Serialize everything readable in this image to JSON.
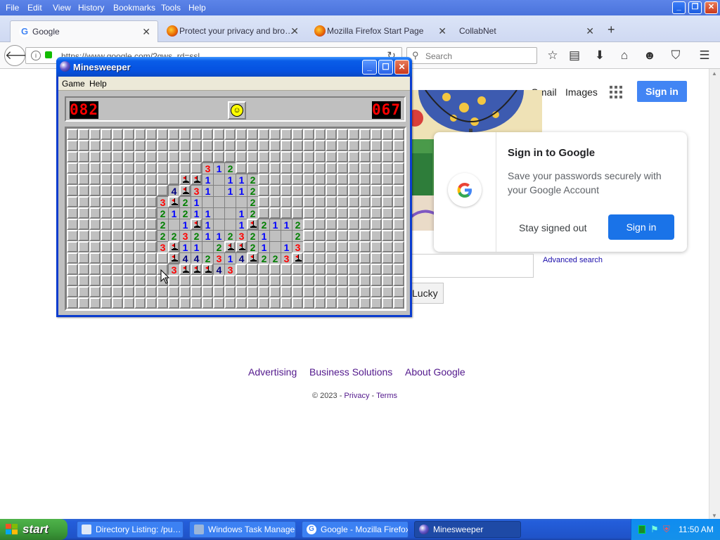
{
  "firefox": {
    "menu": [
      "File",
      "Edit",
      "View",
      "History",
      "Bookmarks",
      "Tools",
      "Help"
    ],
    "tabs": [
      {
        "label": "Google",
        "active": true
      },
      {
        "label": "Protect your privacy and bro…",
        "active": false
      },
      {
        "label": "Mozilla Firefox Start Page",
        "active": false
      },
      {
        "label": "CollabNet",
        "active": false
      }
    ],
    "new_tab": "+",
    "url": "https://www.google.com/?gws_rd=ssl",
    "search_placeholder": "Search"
  },
  "google": {
    "gmail": "Gmail",
    "images": "Images",
    "sign_in": "Sign in",
    "popup": {
      "title": "Sign in to Google",
      "body": "Save your passwords securely with your Google Account",
      "stay": "Stay signed out",
      "sign_in": "Sign in"
    },
    "advanced_search": "Advanced search",
    "lucky": "Lucky",
    "footer": [
      "Advertising",
      "Business Solutions",
      "About Google"
    ],
    "copyright": "© 2023 - ",
    "privacy": "Privacy",
    "sep": " - ",
    "terms": "Terms"
  },
  "minesweeper": {
    "title": "Minesweeper",
    "menu": [
      "Game",
      "Help"
    ],
    "mine_counter": "082",
    "timer": "067",
    "cols": 30,
    "rows": 16,
    "number_colors": {
      "1": "#0000ff",
      "2": "#008000",
      "3": "#ff0000",
      "4": "#000080"
    },
    "revealed": [
      "r3c12:3",
      "r3c13:1",
      "r3c14:2",
      "r4c10:1",
      "r4c11:1",
      "r4c12:1",
      "r4c13:.",
      "r4c14:1",
      "r4c15:1",
      "r4c16:2",
      "r5c9:4",
      "r5c10:F",
      "r5c11:3",
      "r5c12:1",
      "r5c13:.",
      "r5c14:1",
      "r5c15:1",
      "r5c16:2",
      "r6c8:3",
      "r6c9:1",
      "r6c10:2",
      "r6c11:1",
      "r6c12:.",
      "r6c13:.",
      "r6c14:.",
      "r6c15:.",
      "r6c16:2",
      "r7c8:2",
      "r7c9:1",
      "r7c10:2",
      "r7c11:1",
      "r7c12:1",
      "r7c13:.",
      "r7c14:.",
      "r7c15:1",
      "r7c16:2",
      "r8c8:2",
      "r8c9:.",
      "r8c10:1",
      "r8c11:F",
      "r8c12:1",
      "r8c13:.",
      "r8c14:.",
      "r8c15:1",
      "r8c16:F",
      "r8c17:2",
      "r8c18:1",
      "r8c19:1",
      "r8c20:2",
      "r9c8:2",
      "r9c9:2",
      "r9c10:3",
      "r9c11:2",
      "r9c12:1",
      "r9c13:1",
      "r9c14:2",
      "r9c15:3",
      "r9c16:2",
      "r9c17:1",
      "r9c18:.",
      "r9c19:.",
      "r9c20:2",
      "r10c8:3",
      "r10c9:1",
      "r10c10:1",
      "r10c11:1",
      "r10c12:.",
      "r10c13:2",
      "r10c14:1",
      "r10c15:1",
      "r10c16:2",
      "r10c17:1",
      "r10c18:.",
      "r10c19:1",
      "r10c20:3",
      "r11c9:4",
      "r11c10:4",
      "r11c11:4",
      "r11c12:2",
      "r11c13:3",
      "r11c14:1",
      "r11c15:4",
      "r11c16:1",
      "r11c17:2",
      "r11c18:2",
      "r11c19:3",
      "r11c20:1",
      "r12c9:3",
      "r12c10:1",
      "r12c11:1",
      "r12c12:1",
      "r12c13:4",
      "r12c14:3"
    ],
    "flags": [
      "r4c10",
      "r4c11",
      "r5c10",
      "r6c9",
      "r8c11",
      "r8c16",
      "r10c9",
      "r10c14",
      "r10c15",
      "r11c9",
      "r11c16",
      "r11c20",
      "r12c10",
      "r12c11",
      "r12c12"
    ]
  },
  "taskbar": {
    "start": "start",
    "tasks": [
      {
        "label": "Directory Listing: /pu…",
        "active": false
      },
      {
        "label": "Windows Task Manager",
        "active": false
      },
      {
        "label": "Google - Mozilla Firefox",
        "active": false
      },
      {
        "label": "Minesweeper",
        "active": true
      }
    ],
    "clock": "11:50 AM"
  }
}
